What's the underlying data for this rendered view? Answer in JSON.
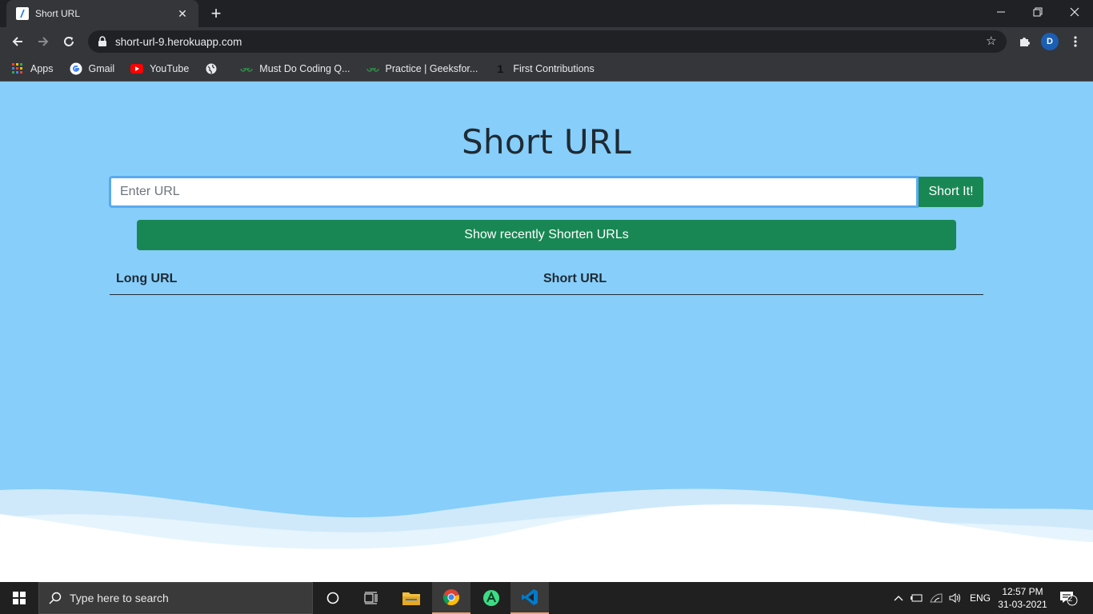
{
  "browser": {
    "tab_title": "Short URL",
    "address": "short-url-9.herokuapp.com",
    "profile_initial": "D",
    "bookmarks": [
      {
        "label": "Apps",
        "icon": "apps-grid-icon"
      },
      {
        "label": "Gmail",
        "icon": "google-icon"
      },
      {
        "label": "YouTube",
        "icon": "youtube-icon"
      },
      {
        "label": "",
        "icon": "globe-icon"
      },
      {
        "label": "Must Do Coding Q...",
        "icon": "geeksforgeeks-icon"
      },
      {
        "label": "Practice | Geeksfor...",
        "icon": "geeksforgeeks-icon"
      },
      {
        "label": "First Contributions",
        "icon": "first-contributions-icon"
      }
    ]
  },
  "page": {
    "title": "Short URL",
    "url_placeholder": "Enter URL",
    "url_value": "",
    "short_button": "Short It!",
    "recent_button": "Show recently Shorten URLs",
    "table": {
      "col_long": "Long URL",
      "col_short": "Short URL"
    }
  },
  "taskbar": {
    "search_placeholder": "Type here to search",
    "language": "ENG",
    "time": "12:57 PM",
    "date": "31-03-2021",
    "notification_count": "2"
  },
  "colors": {
    "page_background": "#87cefa",
    "primary_button": "#198754",
    "input_focus_border": "#5aaaf0"
  }
}
